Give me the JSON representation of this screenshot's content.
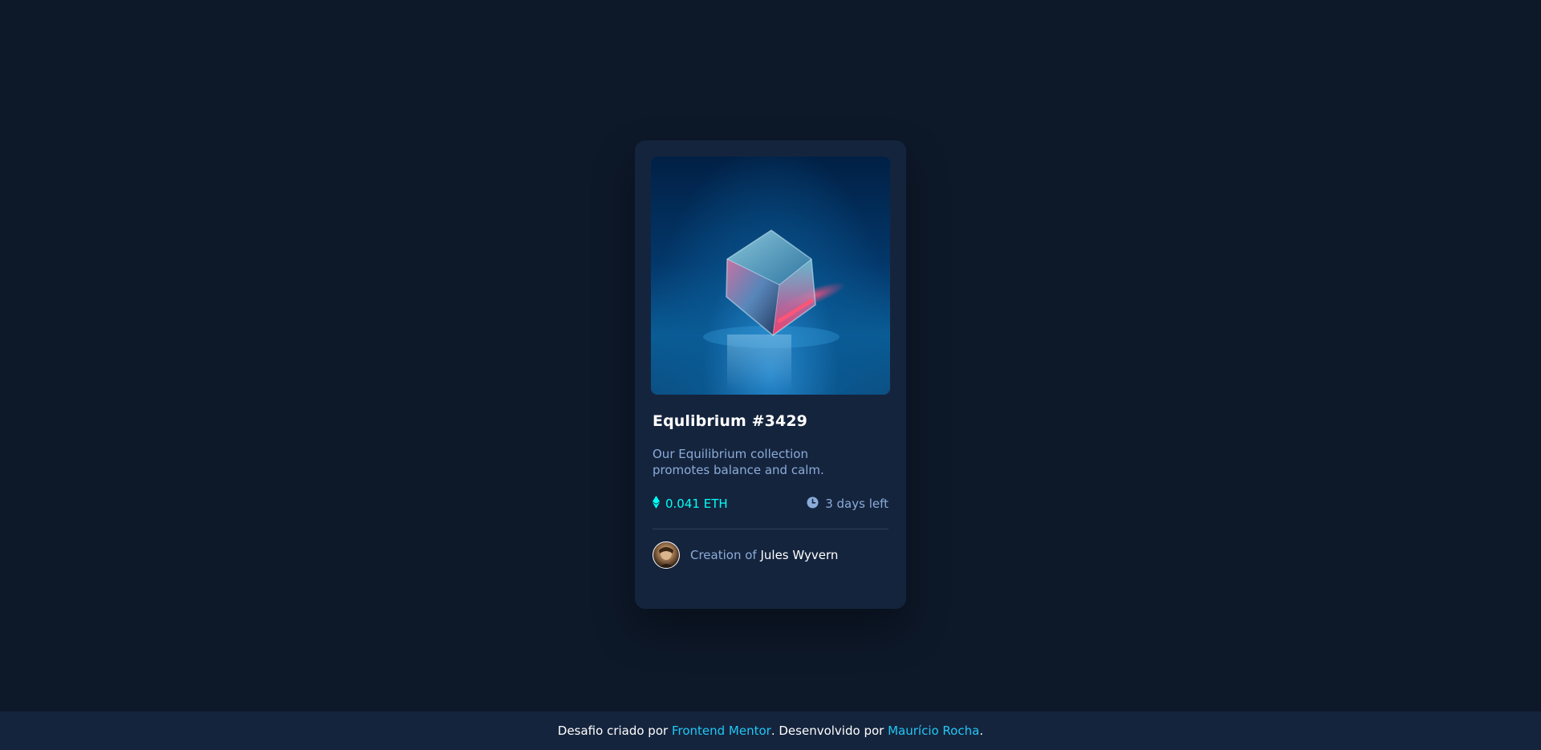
{
  "card": {
    "title": "Equlibrium #3429",
    "description": "Our Equilibrium collection promotes balance and calm.",
    "price": "0.041 ETH",
    "time_left": "3 days left",
    "creator_prefix": "Creation of",
    "creator_name": "Jules Wyvern"
  },
  "footer": {
    "text_1": "Desafio criado por",
    "link_1": "Frontend Mentor",
    "text_2": ". Desenvolvido por",
    "link_2": "Maurício Rocha",
    "text_3": "."
  },
  "icons": {
    "price": "ethereum-icon",
    "time": "clock-icon"
  },
  "colors": {
    "background": "#0d1829",
    "card": "#15243d",
    "accent": "#00fff8",
    "soft_blue": "#8bacd9",
    "link": "#21c8f6"
  }
}
